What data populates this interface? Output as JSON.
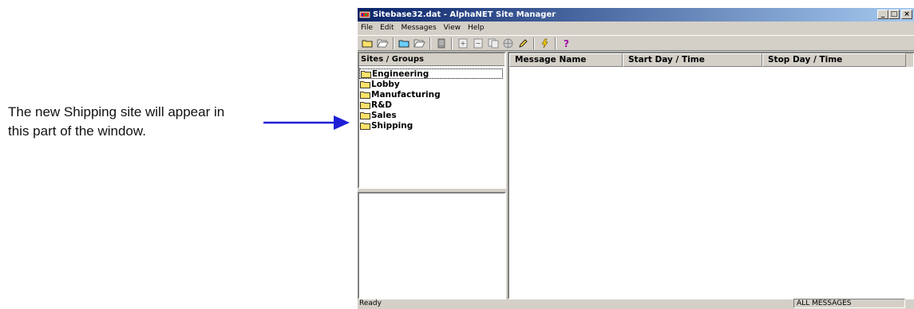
{
  "callout": {
    "line1": "The new Shipping site will appear in",
    "line2": "this part of the window."
  },
  "window": {
    "title": "Sitebase32.dat - AlphaNET Site Manager",
    "minimize": "_",
    "maximize": "□",
    "close": "×"
  },
  "menu": [
    "File",
    "Edit",
    "Messages",
    "View",
    "Help"
  ],
  "toolbar_icons": [
    "open-folder-icon",
    "open-file-icon",
    "folder-icon",
    "file-open-icon",
    "book-icon",
    "plus-doc-icon",
    "minus-doc-icon",
    "copy-doc-icon",
    "globe-icon",
    "pencil-icon",
    "lightning-icon",
    "help-icon"
  ],
  "sites_pane": {
    "header": "Sites / Groups",
    "items": [
      "Engineering",
      "Lobby",
      "Manufacturing",
      "R&D",
      "Sales",
      "Shipping"
    ]
  },
  "messages_pane": {
    "columns": [
      "Message Name",
      "Start Day / Time",
      "Stop Day / Time"
    ]
  },
  "status": {
    "left": "Ready",
    "right": "ALL MESSAGES"
  },
  "colors": {
    "arrow": "#1f1fd6",
    "title_start": "#0a246a",
    "title_end": "#a6caf0",
    "folder": "#ffe16a"
  }
}
